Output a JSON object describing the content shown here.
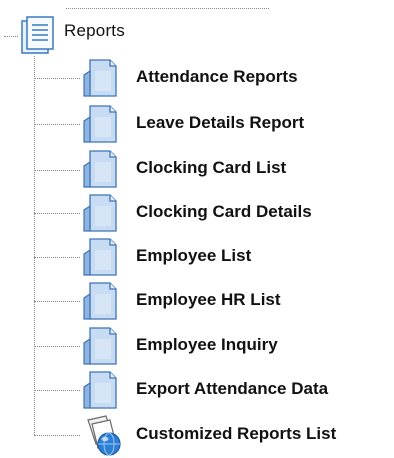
{
  "tree": {
    "root": {
      "label": "Reports",
      "icon": "folder-report-icon"
    },
    "items": [
      {
        "label": "Attendance Reports",
        "icon": "report-page-icon"
      },
      {
        "label": "Leave Details Report",
        "icon": "report-page-icon"
      },
      {
        "label": "Clocking Card List",
        "icon": "report-page-icon"
      },
      {
        "label": "Clocking Card Details",
        "icon": "report-page-icon"
      },
      {
        "label": "Employee List",
        "icon": "report-page-icon"
      },
      {
        "label": "Employee HR List",
        "icon": "report-page-icon"
      },
      {
        "label": "Employee Inquiry",
        "icon": "report-page-icon"
      },
      {
        "label": "Export Attendance Data",
        "icon": "report-page-icon"
      },
      {
        "label": "Customized Reports List",
        "icon": "globe-report-icon"
      }
    ]
  }
}
